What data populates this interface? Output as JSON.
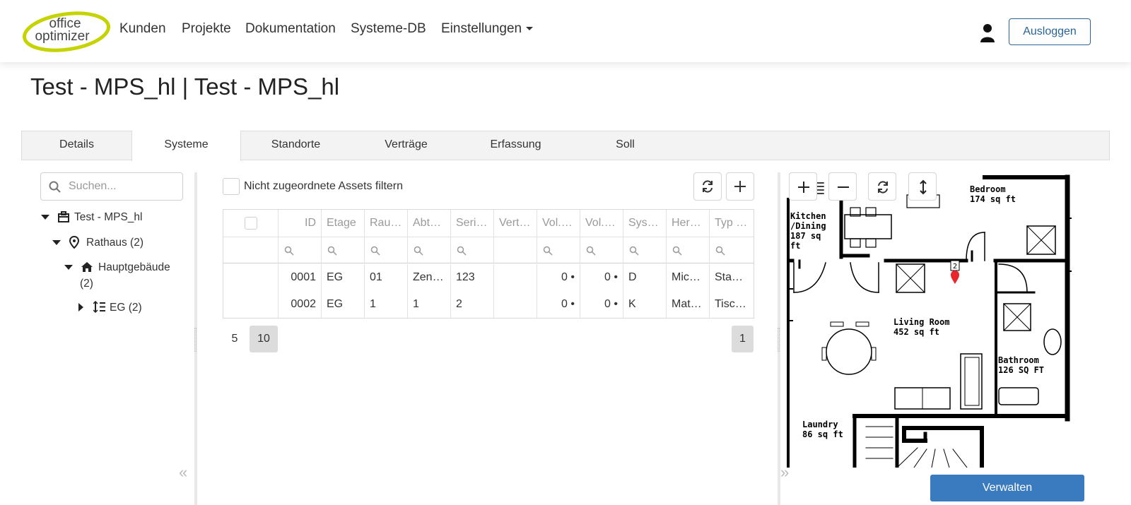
{
  "brand": {
    "logo_line1": "office",
    "logo_line2": "optimizer",
    "accent": "#c5d300"
  },
  "nav": {
    "items": [
      "Kunden",
      "Projekte",
      "Dokumentation",
      "Systeme-DB",
      "Einstellungen"
    ],
    "logout_label": "Ausloggen"
  },
  "page": {
    "title": "Test - MPS_hl | Test - MPS_hl"
  },
  "tabs": [
    {
      "label": "Details",
      "active": false
    },
    {
      "label": "Systeme",
      "active": true
    },
    {
      "label": "Standorte",
      "active": false
    },
    {
      "label": "Verträge",
      "active": false
    },
    {
      "label": "Erfassung",
      "active": false
    },
    {
      "label": "Soll",
      "active": false
    }
  ],
  "tree": {
    "search_placeholder": "Suchen...",
    "nodes": [
      {
        "label": "Test - MPS_hl",
        "icon": "briefcase-icon",
        "expanded": true
      },
      {
        "label": "Rathaus (2)",
        "icon": "map-pin-icon",
        "expanded": true
      },
      {
        "label": "Hauptgebäude",
        "label_cont": "(2)",
        "icon": "home-icon",
        "expanded": true
      },
      {
        "label": "EG (2)",
        "icon": "floor-list-icon",
        "expanded": false
      }
    ]
  },
  "filter": {
    "label": "Nicht zugeordnete Assets filtern",
    "checked": false
  },
  "grid": {
    "columns": [
      "ID",
      "Etage",
      "Rau…",
      "Abt…",
      "Seri…",
      "Vert…",
      "Vol.…",
      "Vol.…",
      "Sys…",
      "Her…",
      "Typ …"
    ],
    "rows": [
      [
        "0001",
        "EG",
        "01",
        "Zen…",
        "123",
        "",
        "0 •",
        "0 •",
        "D",
        "Mic…",
        "Sta…"
      ],
      [
        "0002",
        "EG",
        "1",
        "1",
        "2",
        "",
        "0 •",
        "0 •",
        "K",
        "Mat…",
        "Tisc…"
      ]
    ]
  },
  "pager": {
    "sizes": [
      "5",
      "10"
    ],
    "selected_size": "10",
    "current_page": "1"
  },
  "floorplan": {
    "rooms": [
      {
        "name": "Kitchen",
        "line2": "/Dining",
        "line3": "187 sq",
        "line4": "ft"
      },
      {
        "name": "Bedroom",
        "line2": "174 sq ft"
      },
      {
        "name": "Living Room",
        "line2": "452 sq ft"
      },
      {
        "name": "Bathroom",
        "line2": "126 SQ FT"
      },
      {
        "name": "Laundry",
        "line2": "86 sq ft"
      }
    ],
    "marker_count": "2",
    "marker_color": "#e8262b"
  },
  "manage_label": "Verwalten",
  "colors": {
    "primary": "#3a7bbf",
    "outline_blue": "#2a6496"
  }
}
